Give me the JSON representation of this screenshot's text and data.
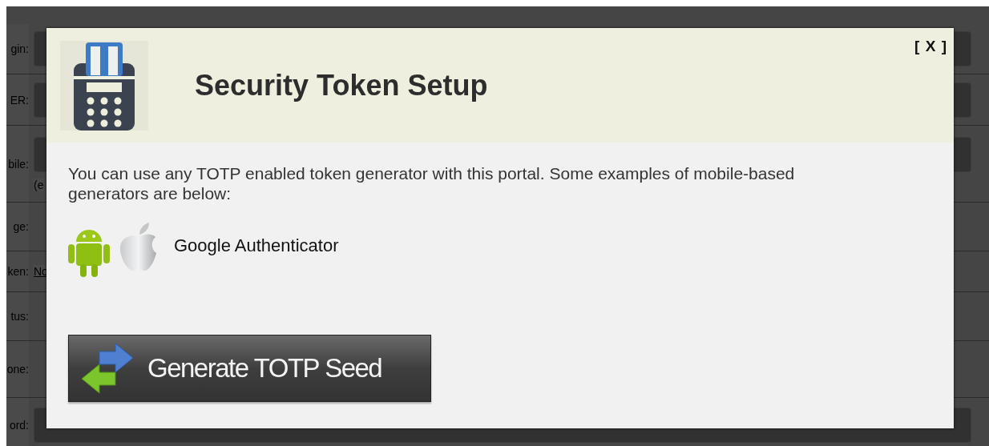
{
  "background_form": {
    "rows": [
      {
        "label": "gin:",
        "kind": "field"
      },
      {
        "label": "ER:",
        "kind": "field"
      },
      {
        "label": "bile:",
        "kind": "field",
        "hint": "(e"
      },
      {
        "label": "ge:",
        "kind": "blank"
      },
      {
        "label": "ken:",
        "kind": "link",
        "link": "No"
      },
      {
        "label": "tus:",
        "kind": "blank"
      },
      {
        "label": "one:",
        "kind": "blank"
      },
      {
        "label": "ord:",
        "kind": "field"
      }
    ]
  },
  "dialog": {
    "title": "Security Token Setup",
    "close": "[ X ]",
    "intro": "You can use any TOTP enabled token generator with this portal. Some examples of mobile-based generators are below:",
    "apps": [
      {
        "name": "Google Authenticator"
      }
    ],
    "button": "Generate TOTP Seed"
  }
}
